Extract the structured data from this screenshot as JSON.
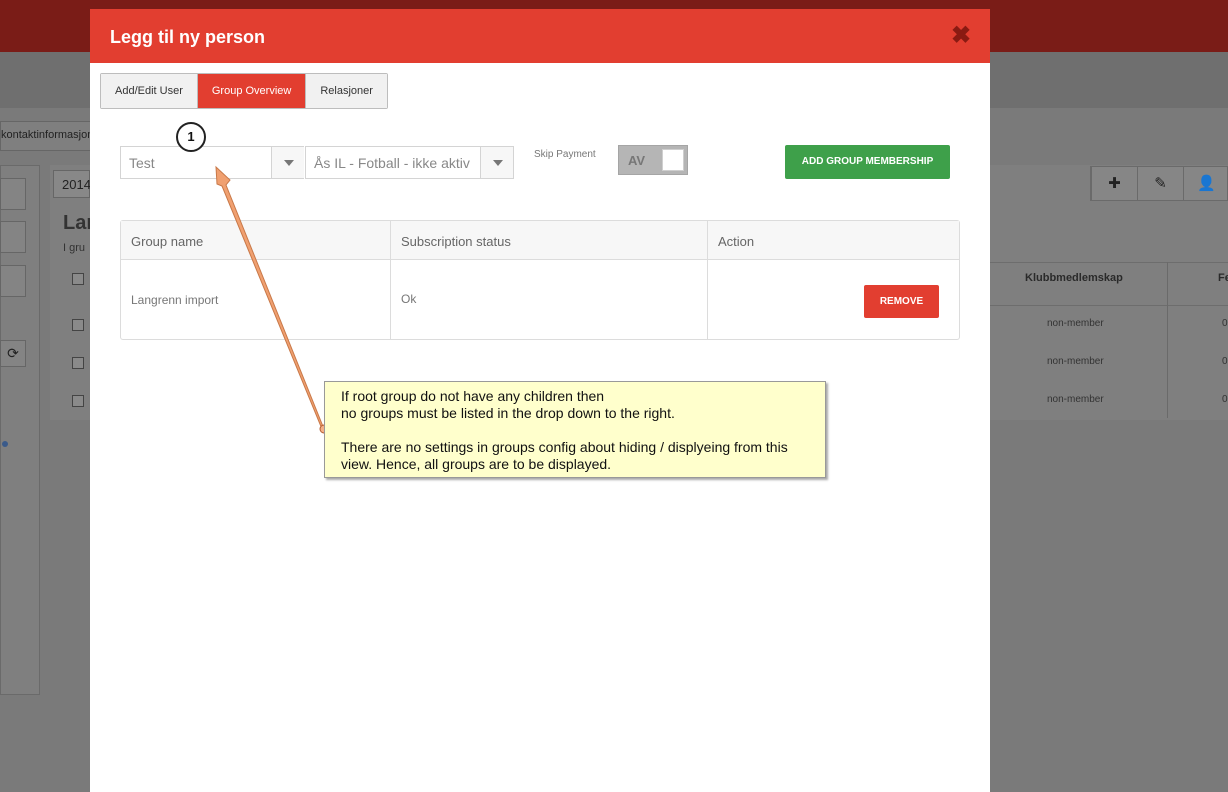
{
  "background": {
    "tab_label": "kontaktinformasjon",
    "year": "2014",
    "heading": "Lan",
    "subtext": "I gru",
    "columns": [
      "Klubbmedlemskap",
      "Fe"
    ],
    "row_values": [
      "non-member",
      "non-member",
      "non-member"
    ],
    "row_suffix": "0"
  },
  "modal": {
    "title": "Legg til ny person",
    "close_glyph": "✖",
    "tabs": [
      {
        "label": "Add/Edit User",
        "active": false
      },
      {
        "label": "Group Overview",
        "active": true
      },
      {
        "label": "Relasjoner",
        "active": false
      }
    ],
    "root_group_select": {
      "value": "Test"
    },
    "child_group_select": {
      "value": "Ås IL - Fotball - ikke aktiv"
    },
    "skip_payment": {
      "label": "Skip Payment",
      "state": "AV"
    },
    "add_button": "ADD GROUP MEMBERSHIP",
    "table": {
      "headers": [
        "Group name",
        "Subscription status",
        "Action"
      ],
      "rows": [
        {
          "group_name": "Langrenn import",
          "status": "Ok",
          "action": "REMOVE"
        }
      ]
    }
  },
  "annotation": {
    "marker": "1",
    "lines_1": [
      "If root group do not have any children then",
      "no groups must be listed in the drop down to the right."
    ],
    "lines_2": [
      "There are no settings in groups config about hiding / displyeing from this",
      "view. Hence, all groups are to be displayed."
    ]
  },
  "colors": {
    "header_red": "#e23e30",
    "add_green": "#3ea04a",
    "note_yellow": "#ffffcc",
    "callout_line": "#f0a070"
  },
  "icons": [
    "close-icon",
    "chevron-down-icon",
    "plus-icon",
    "pencil-icon",
    "user-icon",
    "refresh-icon"
  ]
}
